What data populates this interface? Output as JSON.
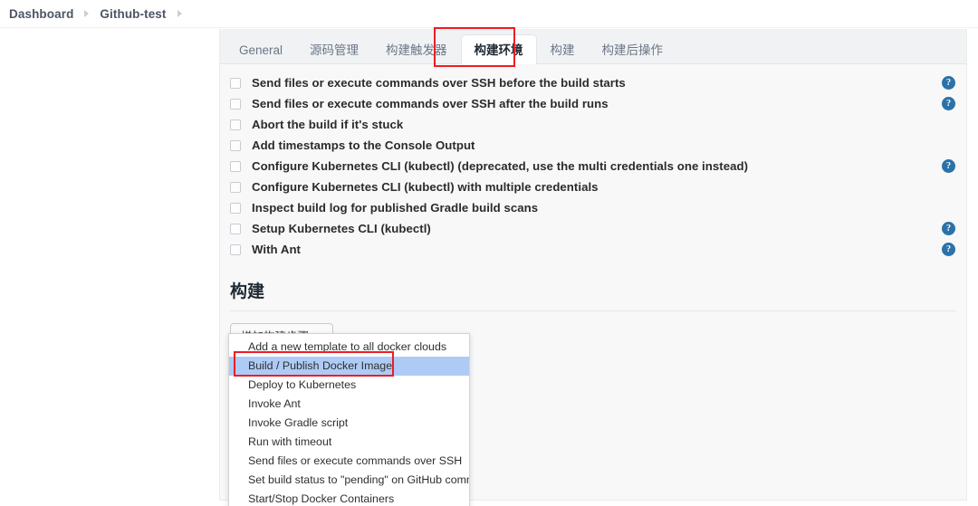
{
  "breadcrumb": {
    "items": [
      "Dashboard",
      "Github-test"
    ],
    "separator_icon": "chevron-right-icon"
  },
  "tabs": [
    {
      "label": "General",
      "active": false
    },
    {
      "label": "源码管理",
      "active": false
    },
    {
      "label": "构建触发器",
      "active": false
    },
    {
      "label": "构建环境",
      "active": true
    },
    {
      "label": "构建",
      "active": false
    },
    {
      "label": "构建后操作",
      "active": false
    }
  ],
  "options": [
    {
      "label": "Send files or execute commands over SSH before the build starts",
      "checked": false,
      "help": true
    },
    {
      "label": "Send files or execute commands over SSH after the build runs",
      "checked": false,
      "help": true
    },
    {
      "label": "Abort the build if it's stuck",
      "checked": false,
      "help": false
    },
    {
      "label": "Add timestamps to the Console Output",
      "checked": false,
      "help": false
    },
    {
      "label": "Configure Kubernetes CLI (kubectl) (deprecated, use the multi credentials one instead)",
      "checked": false,
      "help": true
    },
    {
      "label": "Configure Kubernetes CLI (kubectl) with multiple credentials",
      "checked": false,
      "help": false
    },
    {
      "label": "Inspect build log for published Gradle build scans",
      "checked": false,
      "help": false
    },
    {
      "label": "Setup Kubernetes CLI (kubectl)",
      "checked": false,
      "help": true
    },
    {
      "label": "With Ant",
      "checked": false,
      "help": true
    }
  ],
  "build_section": {
    "heading": "构建",
    "add_step_button": "增加构建步骤",
    "caret_icon": "caret-up-icon"
  },
  "dropdown": {
    "items": [
      {
        "label": "Add a new template to all docker clouds",
        "highlighted": false
      },
      {
        "label": "Build / Publish Docker Image",
        "highlighted": true
      },
      {
        "label": "Deploy to Kubernetes",
        "highlighted": false
      },
      {
        "label": "Invoke Ant",
        "highlighted": false
      },
      {
        "label": "Invoke Gradle script",
        "highlighted": false
      },
      {
        "label": "Run with timeout",
        "highlighted": false
      },
      {
        "label": "Send files or execute commands over SSH",
        "highlighted": false
      },
      {
        "label": "Set build status to \"pending\" on GitHub commit",
        "highlighted": false
      },
      {
        "label": "Start/Stop Docker Containers",
        "highlighted": false
      }
    ]
  },
  "annotations": {
    "tab_highlight_color": "#ee1c25",
    "menu_highlight_color": "#ee1c25",
    "selected_row_color": "#aecbf5",
    "help_icon_color": "#2b72a8"
  },
  "help_icon_glyph": "?"
}
